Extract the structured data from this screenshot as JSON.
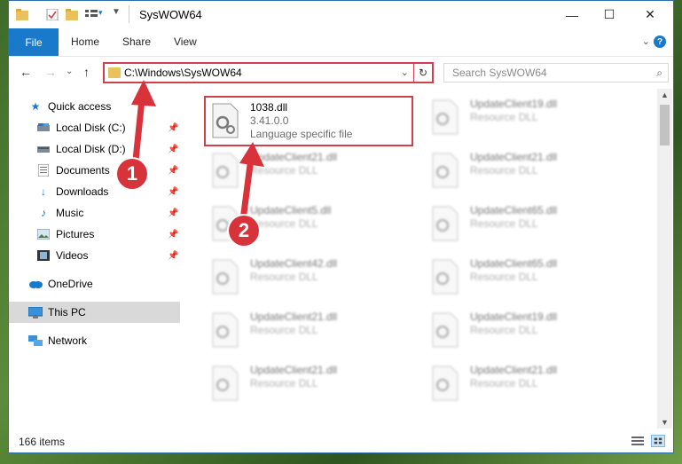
{
  "window": {
    "title": "SysWOW64",
    "controls": {
      "minimize": "—",
      "maximize": "☐",
      "close": "✕"
    }
  },
  "ribbon": {
    "tabs": [
      "File",
      "Home",
      "Share",
      "View"
    ]
  },
  "address": {
    "path": "C:\\Windows\\SysWOW64",
    "search_placeholder": "Search SysWOW64"
  },
  "nav": {
    "items": [
      {
        "label": "Quick access",
        "icon": "star-icon"
      },
      {
        "label": "Local Disk (C:)",
        "icon": "drive-icon",
        "pinned": true
      },
      {
        "label": "Local Disk (D:)",
        "icon": "drive-icon",
        "pinned": true
      },
      {
        "label": "Documents",
        "icon": "documents-icon",
        "pinned": true
      },
      {
        "label": "Downloads",
        "icon": "download-icon",
        "pinned": true
      },
      {
        "label": "Music",
        "icon": "music-icon",
        "pinned": true
      },
      {
        "label": "Pictures",
        "icon": "pictures-icon",
        "pinned": true
      },
      {
        "label": "Videos",
        "icon": "videos-icon",
        "pinned": true
      },
      {
        "label": "OneDrive",
        "icon": "onedrive-icon"
      },
      {
        "label": "This PC",
        "icon": "pc-icon",
        "selected": true
      },
      {
        "label": "Network",
        "icon": "network-icon"
      }
    ]
  },
  "files": {
    "highlighted": {
      "name": "1038.dll",
      "version": "3.41.0.0",
      "description": "Language specific file"
    },
    "left_col": [
      {
        "name": "UpdateClient21.dll",
        "type": "Resource DLL"
      },
      {
        "name": "UpdateClient5.dll",
        "type": "Resource DLL"
      },
      {
        "name": "UpdateClient42.dll",
        "type": "Resource DLL"
      },
      {
        "name": "UpdateClient21.dll",
        "type": "Resource DLL"
      },
      {
        "name": "UpdateClient21.dll",
        "type": "Resource DLL"
      }
    ],
    "right_col": [
      {
        "name": "UpdateClient19.dll",
        "type": "Resource DLL"
      },
      {
        "name": "UpdateClient21.dll",
        "type": "Resource DLL"
      },
      {
        "name": "UpdateClient65.dll",
        "type": "Resource DLL"
      },
      {
        "name": "UpdateClient65.dll",
        "type": "Resource DLL"
      },
      {
        "name": "UpdateClient19.dll",
        "type": "Resource DLL"
      },
      {
        "name": "UpdateClient21.dll",
        "type": "Resource DLL"
      }
    ]
  },
  "status": {
    "item_count": "166 items"
  },
  "annotations": {
    "marker1": "1",
    "marker2": "2"
  },
  "colors": {
    "accent": "#1979ca",
    "highlight": "#d0404c",
    "marker": "#d8333b"
  }
}
